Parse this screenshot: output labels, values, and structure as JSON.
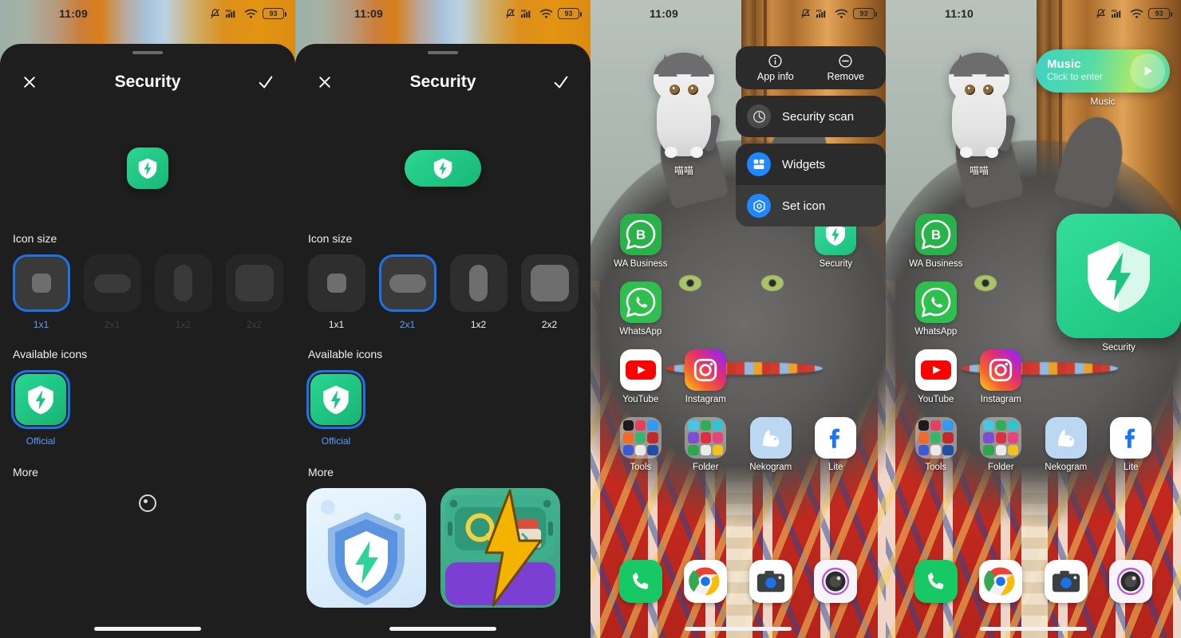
{
  "panels": [
    {
      "id": "editor-1x1",
      "statusbar": {
        "time": "11:09",
        "battery": "93",
        "icons": [
          "mute-icon",
          "hd-signal-icon",
          "wifi-icon",
          "battery-icon"
        ]
      },
      "sheet": {
        "title": "Security",
        "close_label": "close-icon",
        "confirm_label": "check-icon",
        "icon_size_label": "Icon size",
        "available_icons_label": "Available icons",
        "more_label": "More",
        "selected_size": "1x1",
        "sizes": [
          {
            "label": "1x1",
            "selected": true,
            "dimmed": false
          },
          {
            "label": "2x1",
            "selected": false,
            "dimmed": true
          },
          {
            "label": "1x2",
            "selected": false,
            "dimmed": true
          },
          {
            "label": "2x2",
            "selected": false,
            "dimmed": true
          }
        ],
        "available": [
          {
            "label": "Official",
            "selected": true
          }
        ],
        "more_state": "loading"
      }
    },
    {
      "id": "editor-2x1",
      "statusbar": {
        "time": "11:09",
        "battery": "93",
        "icons": [
          "mute-icon",
          "hd-signal-icon",
          "wifi-icon",
          "battery-icon"
        ]
      },
      "sheet": {
        "title": "Security",
        "close_label": "close-icon",
        "confirm_label": "check-icon",
        "icon_size_label": "Icon size",
        "available_icons_label": "Available icons",
        "more_label": "More",
        "selected_size": "2x1",
        "sizes": [
          {
            "label": "1x1",
            "selected": false,
            "dimmed": false
          },
          {
            "label": "2x1",
            "selected": true,
            "dimmed": false
          },
          {
            "label": "1x2",
            "selected": false,
            "dimmed": false
          },
          {
            "label": "2x2",
            "selected": false,
            "dimmed": false
          }
        ],
        "available": [
          {
            "label": "Official",
            "selected": true
          }
        ],
        "more_state": "tiles",
        "more_tiles": [
          "blue-shield-icon-thumb",
          "green-toolbox-icon-thumb"
        ]
      }
    },
    {
      "id": "home-context-menu",
      "statusbar": {
        "time": "11:09",
        "battery": "93",
        "icons": [
          "mute-icon",
          "hd-signal-icon",
          "wifi-icon",
          "battery-icon"
        ]
      },
      "cat_widget": {
        "label": "喵喵"
      },
      "context_menu": {
        "top_items": [
          {
            "label": "App info",
            "icon": "info-icon"
          },
          {
            "label": "Remove",
            "icon": "minus-circle-icon"
          }
        ],
        "items": [
          {
            "label": "Security scan",
            "icon": "scan-icon",
            "highlight": false
          },
          {
            "label": "Widgets",
            "icon": "widgets-icon",
            "highlight": false
          },
          {
            "label": "Set icon",
            "icon": "set-icon-icon",
            "highlight": true
          }
        ]
      },
      "apps": [
        [
          {
            "name": "WA Business",
            "icon": "whatsapp-business-icon"
          },
          {
            "name": "",
            "icon": ""
          },
          {
            "name": "",
            "icon": ""
          },
          {
            "name": "Security",
            "icon": "security-shield-icon"
          }
        ],
        [
          {
            "name": "WhatsApp",
            "icon": "whatsapp-icon"
          },
          {
            "name": "",
            "icon": ""
          },
          {
            "name": "",
            "icon": ""
          },
          {
            "name": "",
            "icon": ""
          }
        ],
        [
          {
            "name": "YouTube",
            "icon": "youtube-icon"
          },
          {
            "name": "Instagram",
            "icon": "instagram-icon"
          },
          {
            "name": "",
            "icon": ""
          },
          {
            "name": "",
            "icon": ""
          }
        ],
        [
          {
            "name": "Tools",
            "icon": "folder-icon"
          },
          {
            "name": "Folder",
            "icon": "folder-icon"
          },
          {
            "name": "Nekogram",
            "icon": "nekogram-icon"
          },
          {
            "name": "Lite",
            "icon": "facebook-lite-icon"
          }
        ]
      ],
      "dock": [
        {
          "name": "Phone",
          "icon": "phone-icon"
        },
        {
          "name": "Chrome",
          "icon": "chrome-icon"
        },
        {
          "name": "Camera",
          "icon": "camera-icon"
        },
        {
          "name": "Gallery",
          "icon": "lens-icon"
        }
      ]
    },
    {
      "id": "home-placed-widget",
      "statusbar": {
        "time": "11:10",
        "battery": "93",
        "icons": [
          "mute-icon",
          "hd-signal-icon",
          "wifi-icon",
          "battery-icon"
        ]
      },
      "cat_widget": {
        "label": "喵喵"
      },
      "music_widget": {
        "title": "Music",
        "subtitle": "Click to enter",
        "label": "Music",
        "play_icon": "play-icon"
      },
      "big_widget": {
        "label": "Security",
        "icon": "security-shield-icon"
      },
      "apps": [
        [
          {
            "name": "WA Business",
            "icon": "whatsapp-business-icon"
          },
          {
            "name": "",
            "icon": ""
          },
          {
            "name": "",
            "icon": ""
          },
          {
            "name": "",
            "icon": ""
          }
        ],
        [
          {
            "name": "WhatsApp",
            "icon": "whatsapp-icon"
          },
          {
            "name": "",
            "icon": ""
          },
          {
            "name": "",
            "icon": ""
          },
          {
            "name": "",
            "icon": ""
          }
        ],
        [
          {
            "name": "YouTube",
            "icon": "youtube-icon"
          },
          {
            "name": "Instagram",
            "icon": "instagram-icon"
          },
          {
            "name": "",
            "icon": ""
          },
          {
            "name": "",
            "icon": ""
          }
        ],
        [
          {
            "name": "Tools",
            "icon": "folder-icon"
          },
          {
            "name": "Folder",
            "icon": "folder-icon"
          },
          {
            "name": "Nekogram",
            "icon": "nekogram-icon"
          },
          {
            "name": "Lite",
            "icon": "facebook-lite-icon"
          }
        ]
      ],
      "dock": [
        {
          "name": "Phone",
          "icon": "phone-icon"
        },
        {
          "name": "Chrome",
          "icon": "chrome-icon"
        },
        {
          "name": "Camera",
          "icon": "camera-icon"
        },
        {
          "name": "Gallery",
          "icon": "lens-icon"
        }
      ]
    }
  ],
  "colors": {
    "accent_blue": "#1a73e8",
    "security_green": "#22cc85",
    "sheet_bg": "#1e1e1e",
    "menu_bg": "#2b2b2b"
  }
}
